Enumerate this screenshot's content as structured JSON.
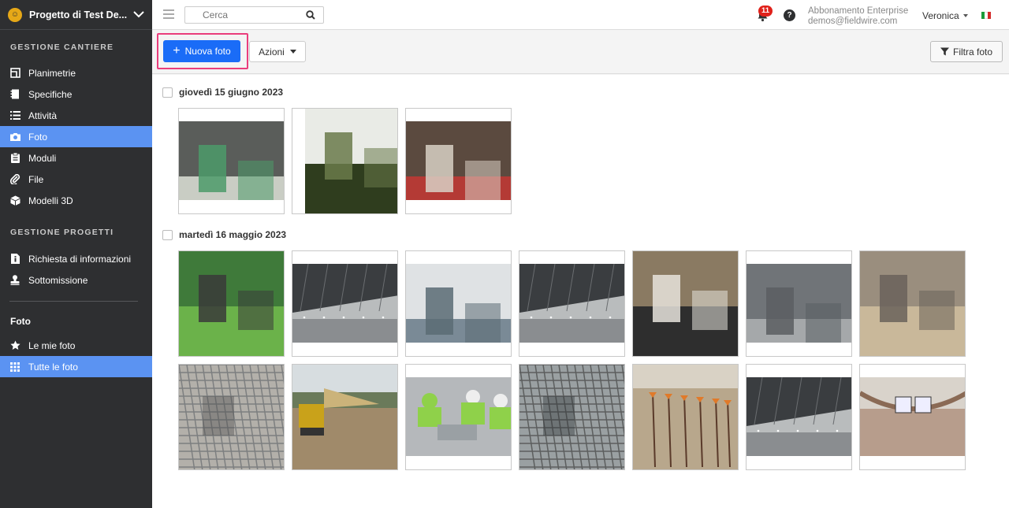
{
  "sidebar": {
    "project_name": "Progetto di Test De...",
    "sections": {
      "cantiere_title": "GESTIONE CANTIERE",
      "progetti_title": "GESTIONE PROGETTI",
      "foto_title": "Foto"
    },
    "cantiere_items": [
      {
        "label": "Planimetrie",
        "icon": "floorplan-icon"
      },
      {
        "label": "Specifiche",
        "icon": "specs-icon"
      },
      {
        "label": "Attività",
        "icon": "list-icon"
      },
      {
        "label": "Foto",
        "icon": "camera-icon",
        "active": true
      },
      {
        "label": "Moduli",
        "icon": "clipboard-icon"
      },
      {
        "label": "File",
        "icon": "paperclip-icon"
      },
      {
        "label": "Modelli 3D",
        "icon": "cube-icon"
      }
    ],
    "progetti_items": [
      {
        "label": "Richiesta di informazioni",
        "icon": "info-doc-icon"
      },
      {
        "label": "Sottomissione",
        "icon": "stamp-icon"
      }
    ],
    "foto_items": [
      {
        "label": "Le mie foto",
        "icon": "star-icon"
      },
      {
        "label": "Tutte le foto",
        "icon": "grid-icon",
        "active": true
      }
    ]
  },
  "topbar": {
    "search_placeholder": "Cerca",
    "notification_count": "11",
    "help_label": "?",
    "account_plan": "Abbonamento Enterprise",
    "account_email": "demos@fieldwire.com",
    "user_name": "Veronica"
  },
  "toolbar": {
    "new_photo_label": "Nuova foto",
    "actions_label": "Azioni",
    "filter_label": "Filtra foto"
  },
  "groups": [
    {
      "date": "giovedì 15 giugno 2023",
      "photos": [
        {
          "scene": "wall-valves",
          "colors": [
            "#5a5d5a",
            "#c9cdc4",
            "#4c9a6a"
          ]
        },
        {
          "scene": "plant",
          "colors": [
            "#e9ebe6",
            "#2f3d1e",
            "#6a7a4a"
          ]
        },
        {
          "scene": "boiler-room",
          "colors": [
            "#5b4a3f",
            "#b43a35",
            "#d8d0c4"
          ]
        }
      ]
    },
    {
      "date": "martedì 16 maggio 2023",
      "photos": [
        {
          "scene": "scissor-lift",
          "colors": [
            "#3f7a3a",
            "#6bb24a",
            "#3a3a3a"
          ]
        },
        {
          "scene": "ceiling",
          "colors": [
            "#3a3d40",
            "#b9bcbd",
            "#8a8d90"
          ]
        },
        {
          "scene": "water-heaters",
          "colors": [
            "#dfe2e4",
            "#7a8a96",
            "#5b6b74"
          ]
        },
        {
          "scene": "ceiling",
          "colors": [
            "#3a3d40",
            "#b9bcbd",
            "#8a8d90"
          ]
        },
        {
          "scene": "duct-pipe",
          "colors": [
            "#8a7a62",
            "#2e2e2e",
            "#e6e3dc"
          ]
        },
        {
          "scene": "concrete-slab",
          "colors": [
            "#707478",
            "#a5a8aa",
            "#5a5e62"
          ]
        },
        {
          "scene": "renovation",
          "colors": [
            "#9a8e7e",
            "#c9b89a",
            "#6a625a"
          ]
        },
        {
          "scene": "rebar-concrete",
          "colors": [
            "#7d7f80",
            "#b3b0aa",
            "#4c4c4c"
          ]
        },
        {
          "scene": "excavator",
          "colors": [
            "#a08a6a",
            "#cbb37a",
            "#c9a21a"
          ]
        },
        {
          "scene": "workers-floor",
          "colors": [
            "#b5b8bb",
            "#8fd14a",
            "#3a3a3a"
          ]
        },
        {
          "scene": "rebar-grid",
          "colors": [
            "#5c5e5e",
            "#9aa0a2",
            "#2e3234"
          ]
        },
        {
          "scene": "survey-stakes",
          "colors": [
            "#b8a78c",
            "#e07a2a",
            "#d9d2c5"
          ]
        },
        {
          "scene": "ceiling",
          "colors": [
            "#3a3d40",
            "#b9bcbd",
            "#8a8d90"
          ]
        },
        {
          "scene": "panorama",
          "colors": [
            "#8a6a55",
            "#d9d3cb",
            "#a07a62"
          ]
        }
      ]
    }
  ]
}
